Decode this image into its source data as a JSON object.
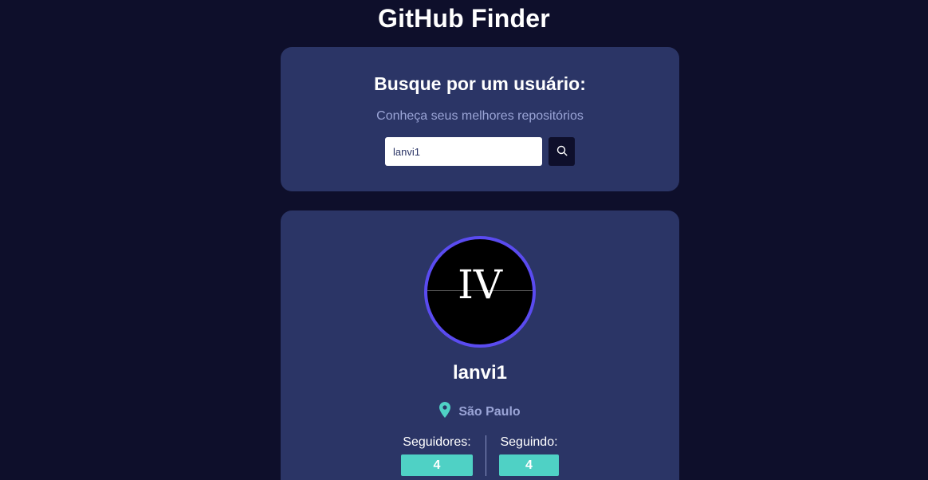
{
  "app": {
    "title": "GitHub Finder"
  },
  "search": {
    "heading": "Busque por um usuário:",
    "subtitle": "Conheça seus melhores repositórios",
    "input_value": "lanvi1",
    "button_icon": "search-icon"
  },
  "profile": {
    "avatar_text": "IV",
    "username": "lanvi1",
    "location_icon": "map-pin-icon",
    "location": "São Paulo",
    "followers_label": "Seguidores:",
    "followers_count": "4",
    "following_label": "Seguindo:",
    "following_count": "4"
  },
  "colors": {
    "background": "#0e0f2b",
    "card": "#2b3566",
    "accent": "#4fd1c5",
    "avatar_border": "#5a4bf0",
    "muted_text": "#9aa4d6"
  }
}
